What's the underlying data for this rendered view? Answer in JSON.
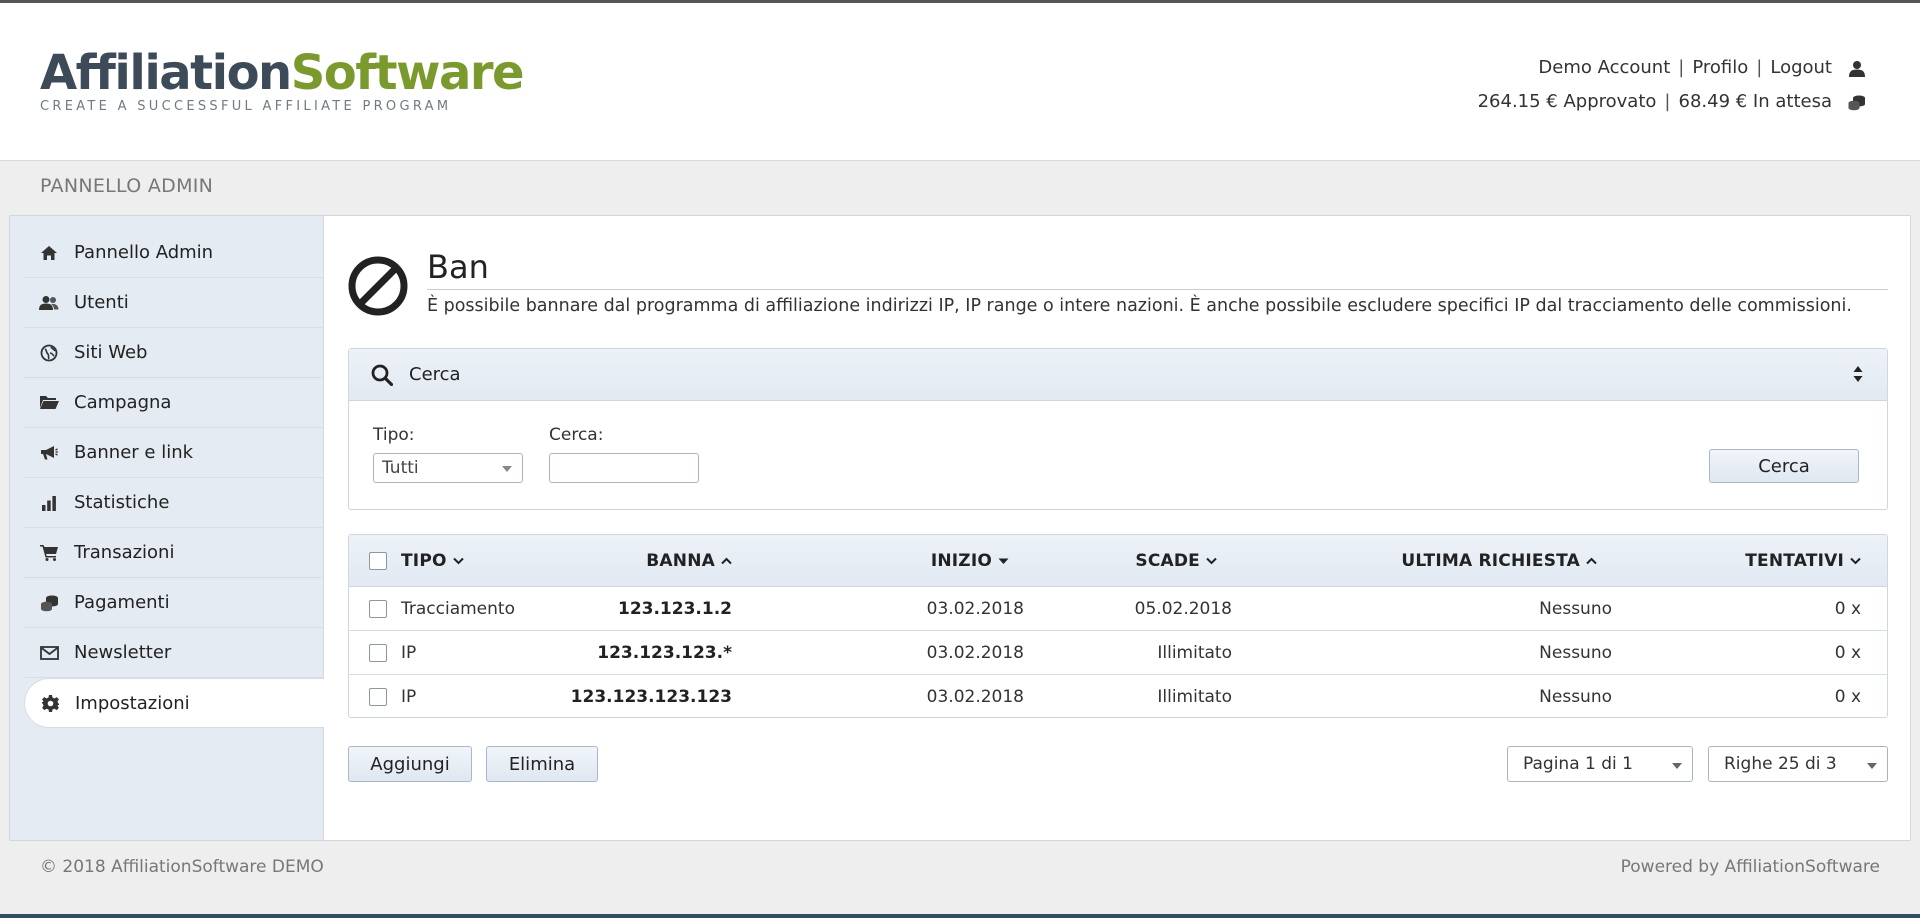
{
  "header": {
    "logo_part1": "Affiliation",
    "logo_part2": "Software",
    "logo_tagline": "CREATE A SUCCESSFUL AFFILIATE PROGRAM",
    "account_name": "Demo Account",
    "profile_link": "Profilo",
    "logout_link": "Logout",
    "separator": "|",
    "approved": "264.15 € Approvato",
    "pending": "68.49 € In attesa",
    "user_icon": "user-icon",
    "coins_icon": "coins-icon"
  },
  "panel": {
    "title": "PANNELLO ADMIN"
  },
  "sidebar": {
    "items": [
      {
        "label": "Pannello Admin",
        "icon": "home-icon"
      },
      {
        "label": "Utenti",
        "icon": "users-icon"
      },
      {
        "label": "Siti Web",
        "icon": "globe-icon"
      },
      {
        "label": "Campagna",
        "icon": "folder-icon"
      },
      {
        "label": "Banner e link",
        "icon": "megaphone-icon"
      },
      {
        "label": "Statistiche",
        "icon": "bar-chart-icon"
      },
      {
        "label": "Transazioni",
        "icon": "cart-icon"
      },
      {
        "label": "Pagamenti",
        "icon": "coins-icon"
      },
      {
        "label": "Newsletter",
        "icon": "envelope-icon"
      },
      {
        "label": "Impostazioni",
        "icon": "gear-icon"
      }
    ],
    "active_index": 9
  },
  "page": {
    "title": "Ban",
    "description": "È possibile bannare dal programma di affiliazione indirizzi IP, IP range o intere nazioni. È anche possibile escludere specifici IP dal tracciamento delle commissioni.",
    "icon": "ban-icon"
  },
  "search": {
    "title": "Cerca",
    "tipo_label": "Tipo:",
    "tipo_value": "Tutti",
    "cerca_label": "Cerca:",
    "cerca_value": "",
    "button_label": "Cerca"
  },
  "table": {
    "columns": {
      "tipo": "TIPO",
      "banna": "BANNA",
      "inizio": "INIZIO",
      "scade": "SCADE",
      "ultima": "ULTIMA RICHIESTA",
      "tentativi": "TENTATIVI"
    },
    "rows": [
      {
        "tipo": "Tracciamento",
        "banna": "123.123.1.2",
        "inizio": "03.02.2018",
        "scade": "05.02.2018",
        "ultima": "Nessuno",
        "tentativi": "0 x"
      },
      {
        "tipo": "IP",
        "banna": "123.123.123.*",
        "inizio": "03.02.2018",
        "scade": "Illimitato",
        "ultima": "Nessuno",
        "tentativi": "0 x"
      },
      {
        "tipo": "IP",
        "banna": "123.123.123.123",
        "inizio": "03.02.2018",
        "scade": "Illimitato",
        "ultima": "Nessuno",
        "tentativi": "0 x"
      }
    ]
  },
  "actions": {
    "add_label": "Aggiungi",
    "delete_label": "Elimina",
    "page_select": "Pagina 1 di 1",
    "rows_select": "Righe 25 di 3"
  },
  "footer": {
    "copyright": "© 2018 AffiliationSoftware DEMO",
    "powered": "Powered by AffiliationSoftware"
  }
}
